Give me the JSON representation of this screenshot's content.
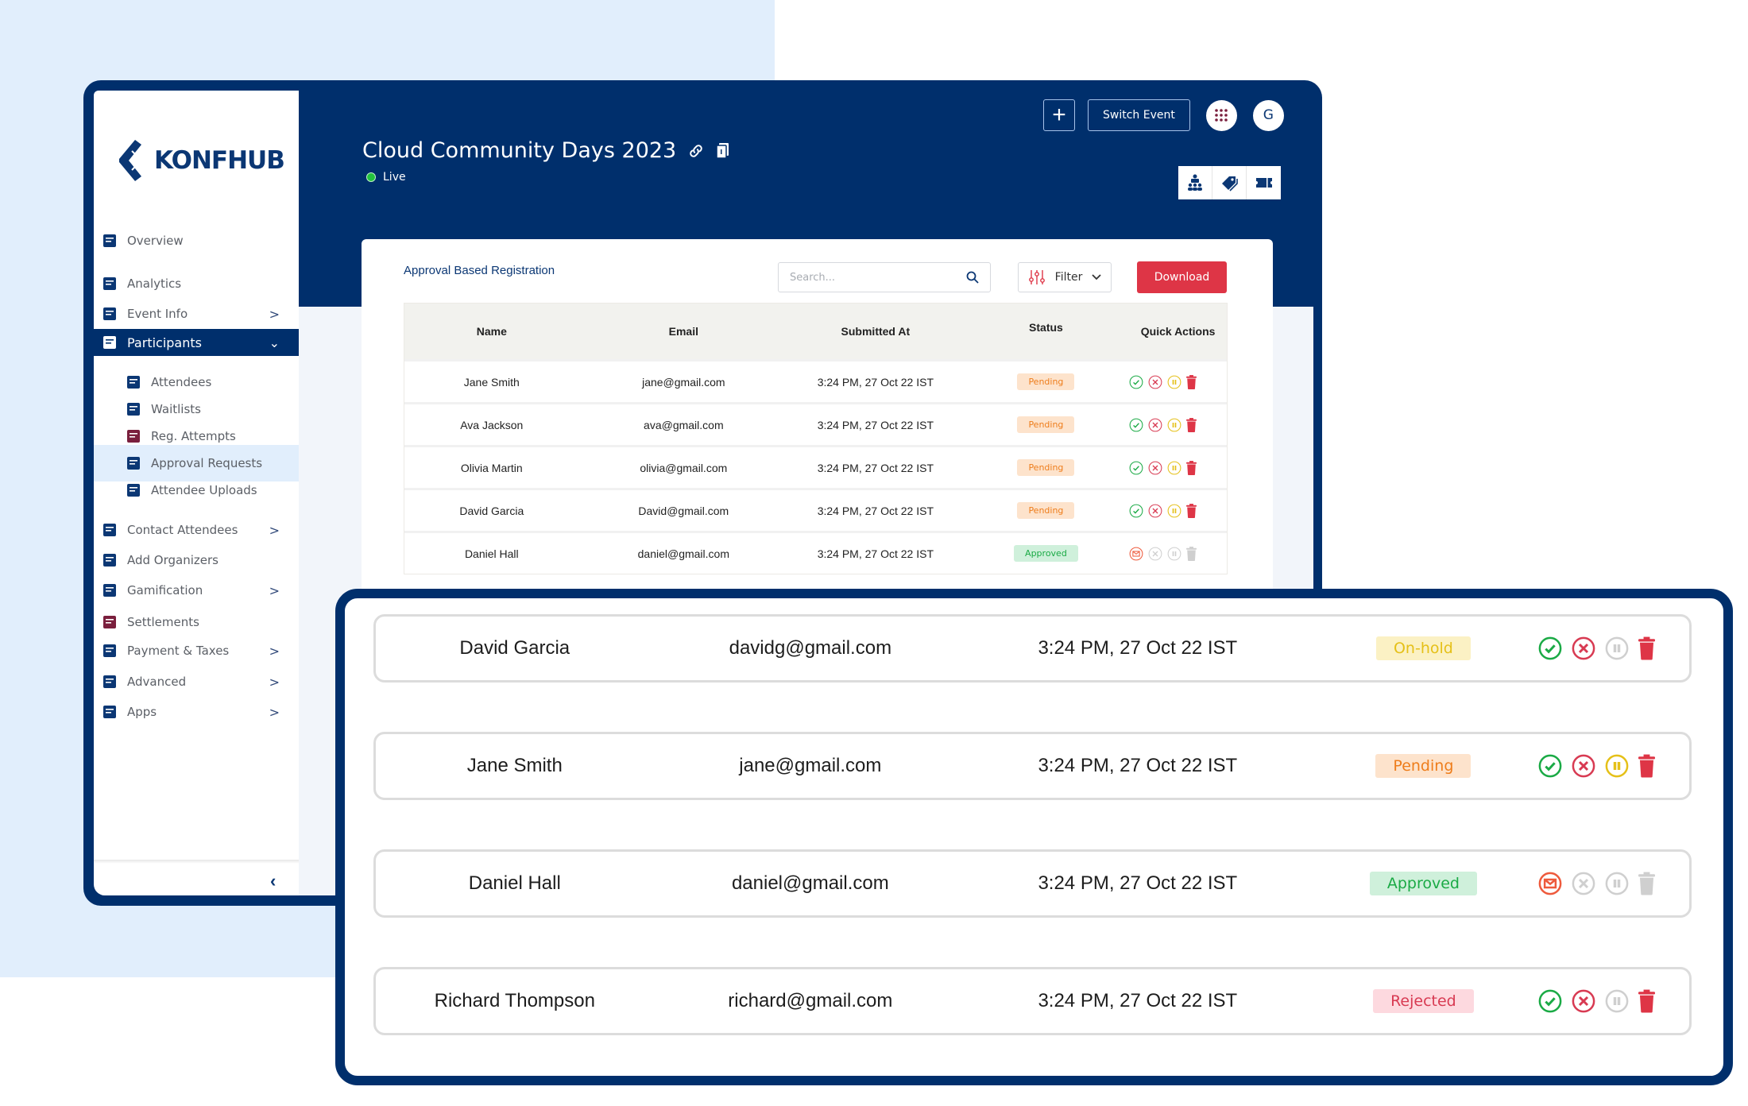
{
  "brand": {
    "name": "KONFHUB"
  },
  "sidebar": {
    "items": [
      {
        "label": "Overview",
        "icon": "overview-icon",
        "chevron": ""
      },
      {
        "label": "Analytics",
        "icon": "analytics-icon",
        "chevron": ""
      },
      {
        "label": "Event Info",
        "icon": "calendar-icon",
        "chevron": ">"
      },
      {
        "label": "Participants",
        "icon": "participants-icon",
        "chevron": "⌄",
        "active": true
      },
      {
        "label": "Attendees",
        "icon": "attendees-icon",
        "sub": true
      },
      {
        "label": "Waitlists",
        "icon": "waitlist-icon",
        "sub": true
      },
      {
        "label": "Reg. Attempts",
        "icon": "reg-attempts-icon",
        "sub": true
      },
      {
        "label": "Approval Requests",
        "icon": "approval-icon",
        "sub": true,
        "selected": true
      },
      {
        "label": "Attendee Uploads",
        "icon": "upload-icon",
        "sub": true
      },
      {
        "label": "Contact Attendees",
        "icon": "contact-icon",
        "chevron": ">"
      },
      {
        "label": "Add Organizers",
        "icon": "add-user-icon",
        "chevron": ""
      },
      {
        "label": "Gamification",
        "icon": "gamepad-icon",
        "chevron": ">"
      },
      {
        "label": "Settlements",
        "icon": "settlements-icon",
        "chevron": ""
      },
      {
        "label": "Payment & Taxes",
        "icon": "payment-icon",
        "chevron": ">"
      },
      {
        "label": "Advanced",
        "icon": "gear-icon",
        "chevron": ">"
      },
      {
        "label": "Apps",
        "icon": "apps-icon",
        "chevron": ">"
      }
    ],
    "collapse": "‹"
  },
  "header": {
    "title": "Cloud Community Days 2023",
    "status": "Live",
    "switch_event": "Switch Event",
    "add_label": "+",
    "avatar_initial": "G"
  },
  "card": {
    "title": "Approval Based Registration",
    "search_placeholder": "Search...",
    "filter_label": "Filter",
    "download_label": "Download"
  },
  "table": {
    "columns": [
      "Name",
      "Email",
      "Submitted At",
      "Status",
      "Quick Actions"
    ],
    "rows": [
      {
        "name": "Jane Smith",
        "email": "jane@gmail.com",
        "submitted": "3:24 PM, 27 Oct 22 IST",
        "status": "Pending"
      },
      {
        "name": "Ava Jackson",
        "email": "ava@gmail.com",
        "submitted": "3:24 PM, 27 Oct 22 IST",
        "status": "Pending"
      },
      {
        "name": "Olivia Martin",
        "email": "olivia@gmail.com",
        "submitted": "3:24 PM, 27 Oct 22 IST",
        "status": "Pending"
      },
      {
        "name": "David Garcia",
        "email": "David@gmail.com",
        "submitted": "3:24 PM, 27 Oct 22 IST",
        "status": "Pending"
      },
      {
        "name": "Daniel Hall",
        "email": "daniel@gmail.com",
        "submitted": "3:24 PM, 27 Oct 22 IST",
        "status": "Approved"
      }
    ]
  },
  "highlight": {
    "rows": [
      {
        "name": "David Garcia",
        "email": "davidg@gmail.com",
        "submitted": "3:24 PM, 27 Oct 22 IST",
        "status": "On-hold"
      },
      {
        "name": "Jane Smith",
        "email": "jane@gmail.com",
        "submitted": "3:24 PM, 27 Oct 22 IST",
        "status": "Pending"
      },
      {
        "name": "Daniel Hall",
        "email": "daniel@gmail.com",
        "submitted": "3:24 PM, 27 Oct 22 IST",
        "status": "Approved"
      },
      {
        "name": "Richard Thompson",
        "email": "richard@gmail.com",
        "submitted": "3:24 PM, 27 Oct 22 IST",
        "status": "Rejected"
      }
    ]
  },
  "colors": {
    "brand_navy": "#002f6c",
    "accent_red": "#de3546",
    "approve_green": "#1aaa45",
    "reject_red": "#d83a52",
    "hold_yellow": "#e5c018",
    "pending_orange": "#ee7d1b",
    "disabled_gray": "#cfcfcf",
    "mail_orange": "#ee5a3c"
  }
}
